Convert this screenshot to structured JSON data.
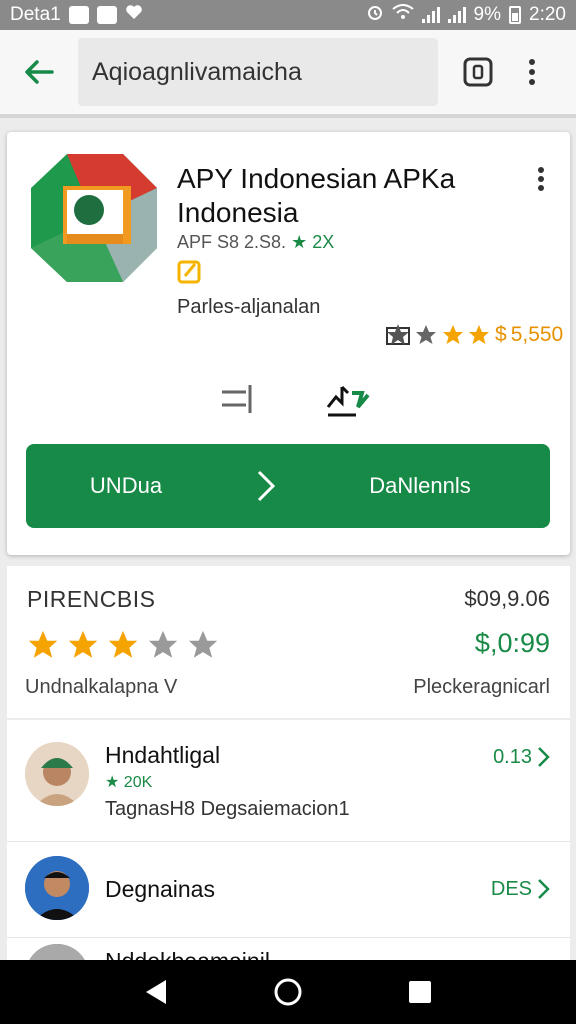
{
  "status_bar": {
    "carrier": "Deta1",
    "battery": "9%",
    "time": "2:20"
  },
  "app_bar": {
    "search_text": "Aqioagnlivamaicha"
  },
  "app": {
    "title": "APY Indonesian APKa Indonesia",
    "meta_prefix": "APF S8 2.S8.",
    "meta_accent": "★ 2X",
    "publisher": "Parles-aljanalan",
    "review_count": "5,550",
    "primary_left_label": "UNDua",
    "primary_right_label": "DaNlennls"
  },
  "price_card": {
    "heading": "PIRENCBIS",
    "old_price": "$09,9.06",
    "new_price": "$,0:99",
    "stars_filled": 3,
    "stars_total": 5,
    "left_caption": "Undnalkalapna V",
    "right_caption": "Pleckeragnicarl"
  },
  "list": {
    "items": [
      {
        "title": "Hndahtligal",
        "sub": "★ 20K",
        "desc": "TagnasH8 Degsaiemacion1",
        "value": "0.13"
      },
      {
        "title": "Degnainas",
        "value": "DES"
      },
      {
        "title": "Nddekbeamainil",
        "value": "..."
      }
    ]
  },
  "colors": {
    "primary_green": "#178a48",
    "accent_orange": "#e69100",
    "star_yellow": "#f4a300"
  }
}
